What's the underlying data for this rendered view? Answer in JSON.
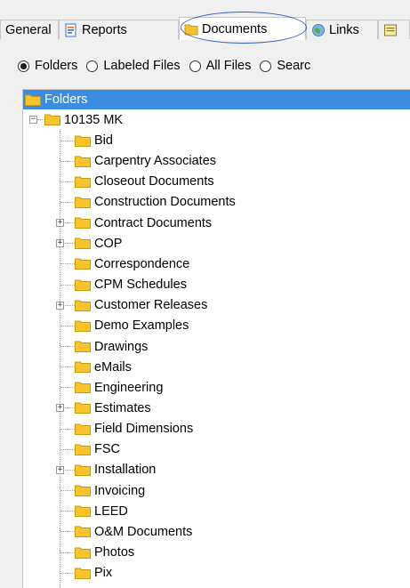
{
  "tabs": [
    {
      "label": "General",
      "icon": "none"
    },
    {
      "label": "Reports",
      "icon": "report-icon"
    },
    {
      "label": "Documents",
      "icon": "folder-icon",
      "active": true
    },
    {
      "label": "Links",
      "icon": "globe-icon"
    },
    {
      "label": "",
      "icon": "notes-icon"
    }
  ],
  "radio_options": [
    {
      "label": "Folders",
      "checked": true
    },
    {
      "label": "Labeled Files",
      "checked": false
    },
    {
      "label": "All Files",
      "checked": false
    },
    {
      "label": "Searc",
      "checked": false
    }
  ],
  "tree": {
    "header": "Folders",
    "root": {
      "label": "10135 MK",
      "expanded": true
    },
    "children": [
      {
        "label": "Bid",
        "expandable": false
      },
      {
        "label": "Carpentry Associates",
        "expandable": false
      },
      {
        "label": "Closeout Documents",
        "expandable": false
      },
      {
        "label": "Construction Documents",
        "expandable": false
      },
      {
        "label": "Contract Documents",
        "expandable": true
      },
      {
        "label": "COP",
        "expandable": true
      },
      {
        "label": "Correspondence",
        "expandable": false
      },
      {
        "label": "CPM Schedules",
        "expandable": false
      },
      {
        "label": "Customer Releases",
        "expandable": true
      },
      {
        "label": "Demo Examples",
        "expandable": false
      },
      {
        "label": "Drawings",
        "expandable": false
      },
      {
        "label": "eMails",
        "expandable": false
      },
      {
        "label": "Engineering",
        "expandable": false
      },
      {
        "label": "Estimates",
        "expandable": true
      },
      {
        "label": "Field Dimensions",
        "expandable": false
      },
      {
        "label": "FSC",
        "expandable": false
      },
      {
        "label": "Installation",
        "expandable": true
      },
      {
        "label": "Invoicing",
        "expandable": false
      },
      {
        "label": "LEED",
        "expandable": false
      },
      {
        "label": "O&M Documents",
        "expandable": false
      },
      {
        "label": "Photos",
        "expandable": false
      },
      {
        "label": "Pix",
        "expandable": false
      }
    ]
  },
  "colors": {
    "header_bg": "#3b8de1",
    "folder_yellow": "#f7c52b",
    "highlight_ellipse": "#2d5fc8"
  }
}
